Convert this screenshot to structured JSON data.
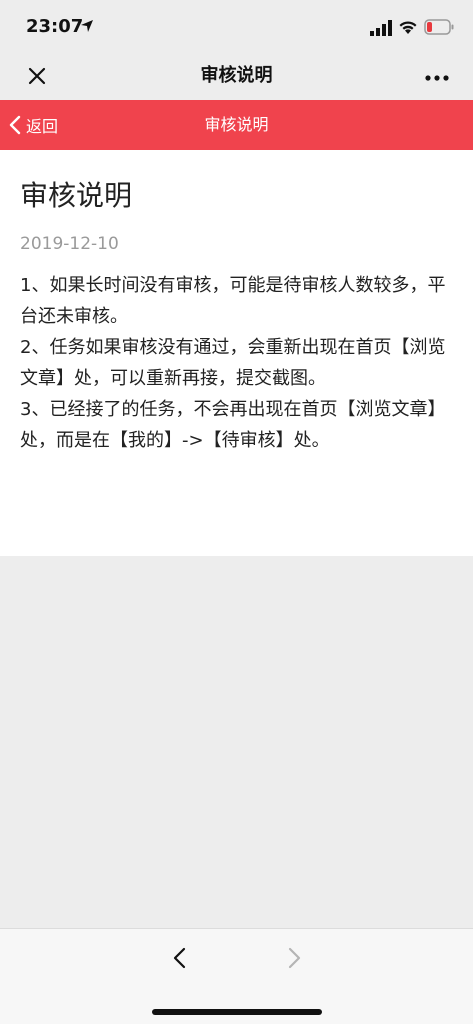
{
  "status_bar": {
    "time": "23:07"
  },
  "wechat_nav": {
    "title": "审核说明",
    "close_icon": "close-icon",
    "more_icon": "more-icon"
  },
  "page_header": {
    "back_label": "返回",
    "title": "审核说明",
    "color": "#f0434d"
  },
  "article": {
    "title": "审核说明",
    "date": "2019-12-10",
    "paragraphs": [
      "1、如果长时间没有审核，可能是待审核人数较多，平台还未审核。",
      "2、任务如果审核没有通过，会重新出现在首页【浏览文章】处，可以重新再接，提交截图。",
      "3、已经接了的任务，不会再出现在首页【浏览文章】处，而是在【我的】->【待审核】处。"
    ]
  },
  "bottom_nav": {
    "back_icon": "chevron-left-icon",
    "forward_icon": "chevron-right-icon"
  }
}
